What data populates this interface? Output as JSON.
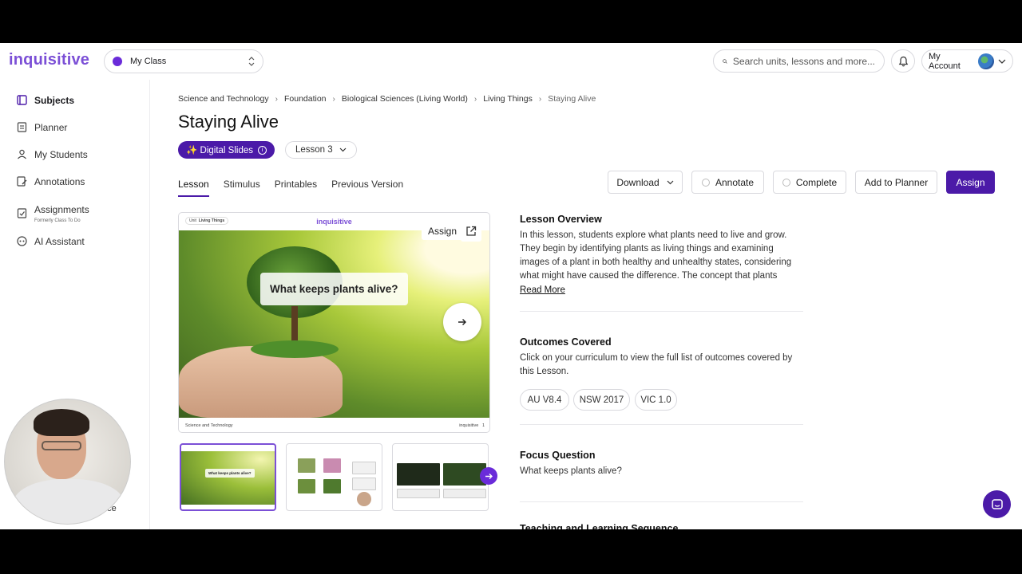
{
  "app": {
    "logo": "inquisitive",
    "class_selector": "My Class",
    "search_placeholder": "Search units, lessons and more...",
    "account_label": "My Account"
  },
  "sidebar": {
    "items": [
      {
        "label": "Subjects",
        "icon": "subjects-icon"
      },
      {
        "label": "Planner",
        "icon": "planner-icon"
      },
      {
        "label": "My Students",
        "icon": "students-icon"
      },
      {
        "label": "Annotations",
        "icon": "annotations-icon"
      },
      {
        "label": "Assignments",
        "sublabel": "Formerly Class To Do",
        "icon": "assignments-icon"
      },
      {
        "label": "AI Assistant",
        "icon": "ai-assistant-icon"
      }
    ],
    "bottom_partial_label": "nce"
  },
  "breadcrumb": [
    "Science and Technology",
    "Foundation",
    "Biological Sciences (Living World)",
    "Living Things",
    "Staying Alive"
  ],
  "page": {
    "title": "Staying Alive",
    "slides_pill": "✨ Digital Slides",
    "lesson_select": "Lesson 3"
  },
  "tabs": [
    "Lesson",
    "Stimulus",
    "Printables",
    "Previous Version"
  ],
  "actions": {
    "download": "Download",
    "annotate": "Annotate",
    "complete": "Complete",
    "add_to_planner": "Add to Planner",
    "assign": "Assign"
  },
  "slide": {
    "unit_tag_label": "Unit",
    "unit_tag_value": "Living Things",
    "logo": "inquisitive",
    "question": "What keeps plants alive?",
    "assign_button": "Assign",
    "footer_left": "Science and Technology",
    "footer_right": "inquisitive",
    "page_number": "1"
  },
  "thumbnails": {
    "first_question": "What keeps plants alive?"
  },
  "overview": {
    "title": "Lesson Overview",
    "text": "In this lesson, students explore what plants need to live and grow. They begin by identifying plants as living things and examining images of a plant in both healthy and unhealthy states, considering what might have caused the difference. The concept that plants",
    "read_more": "Read More"
  },
  "outcomes": {
    "title": "Outcomes Covered",
    "text": "Click on your curriculum to view the full list of outcomes covered by this Lesson.",
    "chips": [
      "AU V8.4",
      "NSW 2017",
      "VIC 1.0"
    ]
  },
  "focus": {
    "title": "Focus Question",
    "text": "What keeps plants alive?"
  },
  "next_section_partial": "Teaching and Learning Sequence",
  "colors": {
    "brand": "#4b1aa8",
    "logo": "#7b4fd6",
    "class_dot": "#6a2bd9"
  }
}
